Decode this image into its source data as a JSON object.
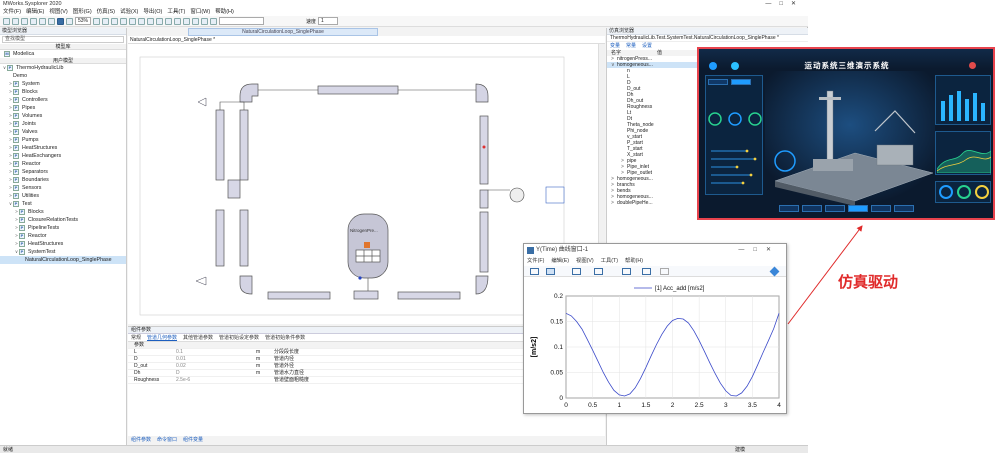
{
  "app": {
    "title": "MWorks.Sysplorer 2020",
    "window_buttons": [
      "—",
      "□",
      "✕"
    ]
  },
  "menu": [
    "文件(F)",
    "编辑(E)",
    "视图(V)",
    "图形(G)",
    "仿真(S)",
    "试验(X)",
    "导出(O)",
    "工具(T)",
    "窗口(W)",
    "帮助(H)"
  ],
  "toolbar": {
    "zoom": "53%",
    "speed_label": "速度",
    "speed_value": "1"
  },
  "left_panel": {
    "header": "模型浏览器",
    "search_placeholder": "查找模型",
    "tab_label": "模型库",
    "root": "Modelica",
    "col_header": "用户模型",
    "items": [
      {
        "label": "ThermoHydraulicLib",
        "depth": 0,
        "exp": "∨",
        "icon": "P"
      },
      {
        "label": "Demo",
        "depth": 1,
        "exp": "",
        "icon": ""
      },
      {
        "label": "System",
        "depth": 1,
        "exp": ">",
        "icon": "P"
      },
      {
        "label": "Blocks",
        "depth": 1,
        "exp": ">",
        "icon": "P"
      },
      {
        "label": "Controllers",
        "depth": 1,
        "exp": ">",
        "icon": "P"
      },
      {
        "label": "Pipes",
        "depth": 1,
        "exp": ">",
        "icon": "P"
      },
      {
        "label": "Volumes",
        "depth": 1,
        "exp": ">",
        "icon": "P"
      },
      {
        "label": "Joints",
        "depth": 1,
        "exp": ">",
        "icon": "P"
      },
      {
        "label": "Valves",
        "depth": 1,
        "exp": ">",
        "icon": "P"
      },
      {
        "label": "Pumps",
        "depth": 1,
        "exp": ">",
        "icon": "P"
      },
      {
        "label": "HeatStructures",
        "depth": 1,
        "exp": ">",
        "icon": "P"
      },
      {
        "label": "HeatExchangers",
        "depth": 1,
        "exp": ">",
        "icon": "P"
      },
      {
        "label": "Reactor",
        "depth": 1,
        "exp": ">",
        "icon": "P"
      },
      {
        "label": "Separators",
        "depth": 1,
        "exp": ">",
        "icon": "P"
      },
      {
        "label": "Boundaries",
        "depth": 1,
        "exp": ">",
        "icon": "P"
      },
      {
        "label": "Sensors",
        "depth": 1,
        "exp": ">",
        "icon": "P"
      },
      {
        "label": "Utilities",
        "depth": 1,
        "exp": ">",
        "icon": "P"
      },
      {
        "label": "Test",
        "depth": 1,
        "exp": "∨",
        "icon": "P"
      },
      {
        "label": "Blocks",
        "depth": 2,
        "exp": ">",
        "icon": "P"
      },
      {
        "label": "ClosureRelationTests",
        "depth": 2,
        "exp": ">",
        "icon": "P"
      },
      {
        "label": "PipelineTests",
        "depth": 2,
        "exp": ">",
        "icon": "P"
      },
      {
        "label": "Reactor",
        "depth": 2,
        "exp": ">",
        "icon": "P"
      },
      {
        "label": "HeatStructures",
        "depth": 2,
        "exp": ">",
        "icon": "P"
      },
      {
        "label": "SystemTest",
        "depth": 2,
        "exp": "∨",
        "icon": "P"
      },
      {
        "label": "NaturalCirculationLoop_SinglePhase",
        "depth": 3,
        "exp": "",
        "icon": "",
        "selected": true
      }
    ]
  },
  "document": {
    "tab": "NaturalCirculationLoop_SinglePhase",
    "breadcrumb": "NaturalCirculationLoop_SinglePhase *",
    "tank_label": "NitrogenPre..."
  },
  "params": {
    "header": "组件参数",
    "tabs": [
      "常规",
      "管道几何参数",
      "其他管道参数",
      "管道初始设定参数",
      "管道初始条件参数"
    ],
    "active_tab": 1,
    "col_header": "参数",
    "rows": [
      {
        "name": "L",
        "value": "0.1",
        "unit": "m",
        "desc": "分段段长度"
      },
      {
        "name": "D",
        "value": "0.01",
        "unit": "m",
        "desc": "管道内径"
      },
      {
        "name": "D_out",
        "value": "0.02",
        "unit": "m",
        "desc": "管道外径"
      },
      {
        "name": "Dh",
        "value": "D",
        "unit": "m",
        "desc": "管道水力直径"
      },
      {
        "name": "Roughness",
        "value": "2.5e-6",
        "unit": "",
        "desc": "管道壁面粗糙度"
      }
    ],
    "bottom_tabs": [
      "组件参数",
      "命令窗口",
      "组件变量"
    ]
  },
  "status": {
    "left": "就绪",
    "right": "建模"
  },
  "right_panel": {
    "header": "仿真浏览器",
    "path": "ThermoHydraulicLib.Test.SystemTest.NaturalCirculationLoop_SinglePhase *",
    "tabs": [
      "变量",
      "常量",
      "设置"
    ],
    "col_name": "名字",
    "col_value": "值",
    "vars": [
      {
        "name": "nitrogenPress...",
        "depth": 0,
        "exp": ">"
      },
      {
        "name": "homogeneous...",
        "depth": 0,
        "exp": "∨",
        "selected": true
      },
      {
        "name": "n",
        "depth": 1,
        "exp": ""
      },
      {
        "name": "L",
        "depth": 1,
        "exp": ""
      },
      {
        "name": "D",
        "depth": 1,
        "exp": ""
      },
      {
        "name": "D_out",
        "depth": 1,
        "exp": ""
      },
      {
        "name": "Dh",
        "depth": 1,
        "exp": ""
      },
      {
        "name": "Dh_out",
        "depth": 1,
        "exp": ""
      },
      {
        "name": "Roughness",
        "depth": 1,
        "exp": ""
      },
      {
        "name": "Lt",
        "depth": 1,
        "exp": ""
      },
      {
        "name": "Dt",
        "depth": 1,
        "exp": ""
      },
      {
        "name": "Theta_node",
        "depth": 1,
        "exp": ""
      },
      {
        "name": "Phi_node",
        "depth": 1,
        "exp": ""
      },
      {
        "name": "v_start",
        "depth": 1,
        "exp": ""
      },
      {
        "name": "P_start",
        "depth": 1,
        "exp": ""
      },
      {
        "name": "T_start",
        "depth": 1,
        "exp": ""
      },
      {
        "name": "X_start",
        "depth": 1,
        "exp": ""
      },
      {
        "name": "pipe",
        "depth": 1,
        "exp": ">"
      },
      {
        "name": "Pipe_inlet",
        "depth": 1,
        "exp": ">"
      },
      {
        "name": "Pipe_outlet",
        "depth": 1,
        "exp": ">"
      },
      {
        "name": "homogeneous...",
        "depth": 0,
        "exp": ">"
      },
      {
        "name": "branchs",
        "depth": 0,
        "exp": ">"
      },
      {
        "name": "bends",
        "depth": 0,
        "exp": ">"
      },
      {
        "name": "homogeneous...",
        "depth": 0,
        "exp": ">"
      },
      {
        "name": "doublePipeHe...",
        "depth": 0,
        "exp": ">"
      }
    ]
  },
  "viz": {
    "title": "运动系统三维演示系统",
    "accent": "#1f9cff",
    "border_color": "#e8434d"
  },
  "plot_window": {
    "title": "Y(Time) 曲线窗口-1",
    "menu": [
      "文件(F)",
      "编辑(E)",
      "视图(V)",
      "工具(T)",
      "帮助(H)"
    ],
    "chart_data": {
      "type": "line",
      "title": "",
      "legend": [
        "[1] Acc_add [m/s2]"
      ],
      "xlabel": "",
      "ylabel": "[m/s2]",
      "xlim": [
        0,
        4
      ],
      "ylim": [
        0,
        0.2
      ],
      "xticks": [
        0,
        0.5,
        1,
        1.5,
        2,
        2.5,
        3,
        3.5,
        4
      ],
      "yticks": [
        0,
        0.05,
        0.1,
        0.15,
        0.2
      ],
      "series": [
        {
          "name": "[1] Acc_add [m/s2]",
          "color": "#3a49c9",
          "x": [
            0,
            0.1,
            0.2,
            0.3,
            0.4,
            0.5,
            0.6,
            0.7,
            0.8,
            0.9,
            1,
            1.1,
            1.2,
            1.3,
            1.4,
            1.5,
            1.6,
            1.7,
            1.8,
            1.9,
            2,
            2.1,
            2.2,
            2.3,
            2.4,
            2.5,
            2.6,
            2.7,
            2.8,
            2.9,
            3,
            3.1,
            3.2,
            3.3,
            3.4,
            3.5,
            3.6,
            3.7,
            3.8,
            3.9,
            4
          ],
          "y": [
            0.166,
            0.161,
            0.15,
            0.135,
            0.115,
            0.094,
            0.072,
            0.05,
            0.031,
            0.015,
            0.006,
            0.004,
            0.008,
            0.02,
            0.038,
            0.06,
            0.083,
            0.105,
            0.125,
            0.141,
            0.152,
            0.156,
            0.155,
            0.147,
            0.132,
            0.113,
            0.091,
            0.069,
            0.048,
            0.029,
            0.014,
            0.005,
            0.004,
            0.01,
            0.023,
            0.042,
            0.065,
            0.089,
            0.112,
            0.136,
            0.166
          ]
        }
      ]
    }
  },
  "annotation": {
    "text": "仿真驱动",
    "color": "#e02a2a"
  }
}
